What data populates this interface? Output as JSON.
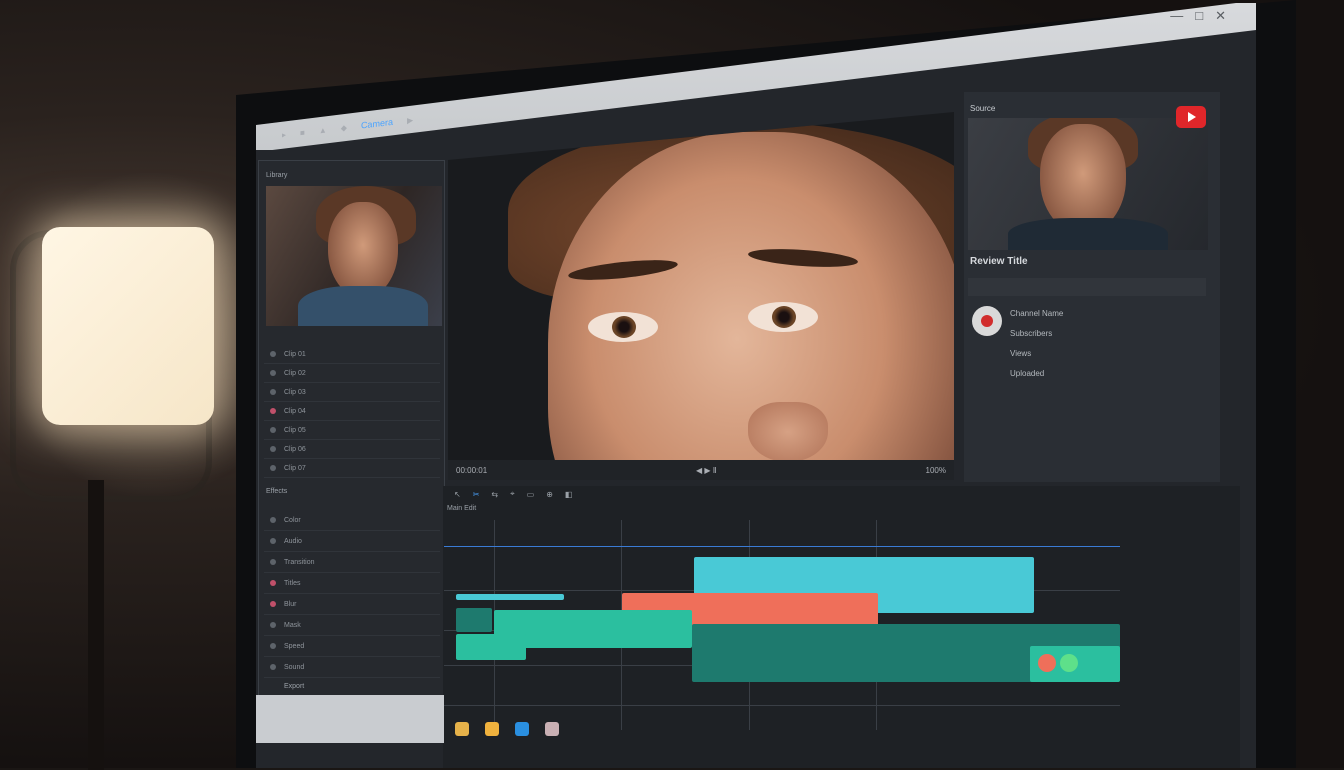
{
  "app": {
    "toolbar_active_label": "Camera",
    "viewer_timecode": "00:00:01",
    "viewer_center_label": "◀ ▶ Ⅱ",
    "viewer_right_label": "100%"
  },
  "left_panel": {
    "header_label": "Library",
    "media_items": [
      "Clip 01",
      "Clip 02",
      "Clip 03",
      "Clip 04",
      "Clip 05",
      "Clip 06",
      "Clip 07"
    ],
    "section_label": "Effects",
    "effects_items": [
      "Color",
      "Audio",
      "Transition",
      "Titles",
      "Blur",
      "Mask",
      "Speed",
      "Sound"
    ],
    "footer_label": "Export"
  },
  "right_panel": {
    "title": "Source",
    "preview_label": "Review Title",
    "channel_lines": [
      "Channel Name",
      "Subscribers",
      "Views",
      "Uploaded"
    ]
  },
  "timeline": {
    "header_label": "Main Edit",
    "tool_labels": [
      "↖",
      "✂",
      "⇆",
      "⌖",
      "▭",
      "⊕",
      "◧"
    ]
  },
  "colors": {
    "clip_cyan": "#49c9d6",
    "clip_salmon": "#ef6f5a",
    "clip_teal": "#2bbf9f",
    "clip_dark_teal": "#1e7a6e",
    "accent_blue": "#4aa3ff",
    "youtube_red": "#e0262a"
  },
  "icons": {
    "window_controls": [
      "minimize-icon",
      "maximize-icon",
      "close-icon"
    ],
    "dock": [
      "folder-icon",
      "folder-icon",
      "app-icon",
      "trash-icon"
    ]
  }
}
